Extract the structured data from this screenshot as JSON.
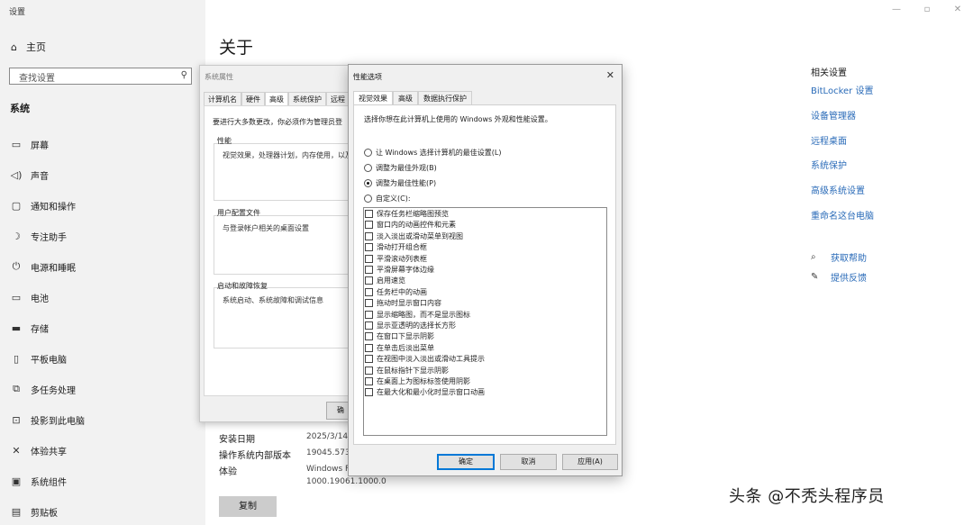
{
  "app": {
    "title": "设置"
  },
  "sidebar": {
    "home": "主页",
    "search_placeholder": "查找设置",
    "section": "系统",
    "items": [
      {
        "label": "屏幕",
        "icon": "monitor-icon"
      },
      {
        "label": "声音",
        "icon": "speaker-icon"
      },
      {
        "label": "通知和操作",
        "icon": "notification-icon"
      },
      {
        "label": "专注助手",
        "icon": "moon-icon"
      },
      {
        "label": "电源和睡眠",
        "icon": "power-icon"
      },
      {
        "label": "电池",
        "icon": "battery-icon"
      },
      {
        "label": "存储",
        "icon": "storage-icon"
      },
      {
        "label": "平板电脑",
        "icon": "tablet-icon"
      },
      {
        "label": "多任务处理",
        "icon": "multitask-icon"
      },
      {
        "label": "投影到此电脑",
        "icon": "projection-icon"
      },
      {
        "label": "体验共享",
        "icon": "share-icon"
      },
      {
        "label": "系统组件",
        "icon": "components-icon"
      },
      {
        "label": "剪贴板",
        "icon": "clipboard-icon"
      }
    ]
  },
  "main": {
    "title": "关于",
    "specs": [
      {
        "label": "安装日期",
        "value": "2025/3/14"
      },
      {
        "label": "操作系统内部版本",
        "value": "19045.5737"
      },
      {
        "label": "体验",
        "value": "Windows F",
        "value2": "1000.19061.1000.0"
      }
    ],
    "copy_button": "复制"
  },
  "related": {
    "heading": "相关设置",
    "links": [
      "BitLocker 设置",
      "设备管理器",
      "远程桌面",
      "系统保护",
      "高级系统设置",
      "重命名这台电脑"
    ],
    "help": "获取帮助",
    "feedback": "提供反馈"
  },
  "system_properties": {
    "title": "系统属性",
    "tabs": [
      "计算机名",
      "硬件",
      "高级",
      "系统保护",
      "远程"
    ],
    "active_tab": "高级",
    "note": "要进行大多数更改，你必须作为管理员登",
    "performance": {
      "label": "性能",
      "text": "视觉效果，处理器计划，内存使用，以及"
    },
    "profile": {
      "label": "用户配置文件",
      "text": "与登录帐户相关的桌面设置"
    },
    "startup": {
      "label": "启动和故障恢复",
      "text": "系统启动、系统故障和调试信息"
    },
    "footer_button": "确"
  },
  "performance_options": {
    "title": "性能选项",
    "tabs": [
      "视觉效果",
      "高级",
      "数据执行保护"
    ],
    "active_tab": "视觉效果",
    "description": "选择你想在此计算机上使用的 Windows 外观和性能设置。",
    "radios": [
      {
        "label": "让 Windows 选择计算机的最佳设置(L)",
        "selected": false
      },
      {
        "label": "调整为最佳外观(B)",
        "selected": false
      },
      {
        "label": "调整为最佳性能(P)",
        "selected": true
      },
      {
        "label": "自定义(C):",
        "selected": false
      }
    ],
    "checkboxes": [
      "保存任务栏缩略图预览",
      "窗口内的动画控件和元素",
      "淡入淡出或滑动菜单到视图",
      "滑动打开组合框",
      "平滑滚动列表框",
      "平滑屏幕字体边缘",
      "启用速览",
      "任务栏中的动画",
      "拖动时显示窗口内容",
      "显示缩略图，而不是显示图标",
      "显示亚透明的选择长方形",
      "在窗口下显示阴影",
      "在单击后淡出菜单",
      "在视图中淡入淡出或滑动工具提示",
      "在鼠标指针下显示阴影",
      "在桌面上为图标标签使用阴影",
      "在最大化和最小化时显示窗口动画"
    ],
    "buttons": {
      "ok": "确定",
      "cancel": "取消",
      "apply": "应用(A)"
    }
  },
  "watermark": "头条 @不秃头程序员"
}
